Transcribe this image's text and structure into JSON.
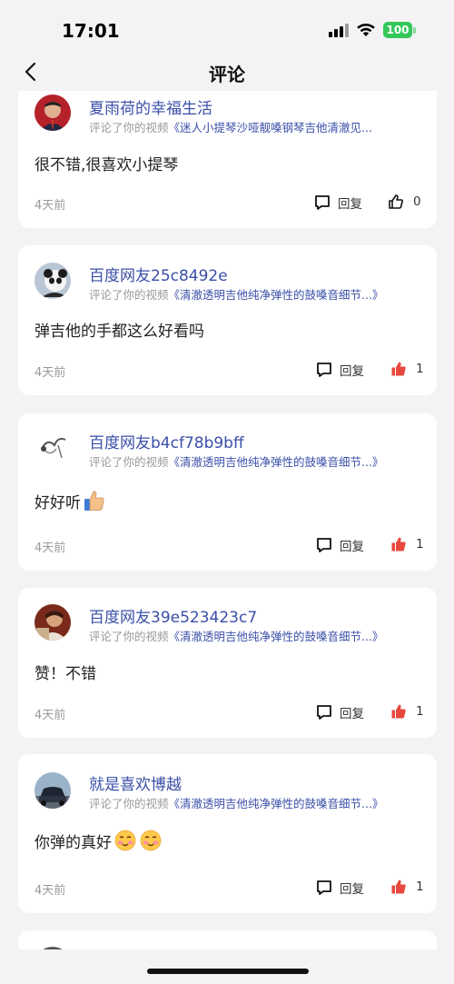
{
  "status_bar": {
    "time": "17:01",
    "battery": "100"
  },
  "nav": {
    "title": "评论"
  },
  "comments": [
    {
      "username": "夏雨荷的幸福生活",
      "prefix": "评论了你的视频",
      "video": "《迷人小提琴沙哑靓嗓钢琴吉他清澈见...",
      "text": "很不错,很喜欢小提琴",
      "time": "4天前",
      "reply_label": "回复",
      "likes": "0",
      "liked": false
    },
    {
      "username": "百度网友25c8492e",
      "prefix": "评论了你的视频",
      "video": "《清澈透明吉他纯净弹性的鼓嗓音细节...》",
      "text": "弹吉他的手都这么好看吗",
      "time": "4天前",
      "reply_label": "回复",
      "likes": "1",
      "liked": true
    },
    {
      "username": "百度网友b4cf78b9bff",
      "prefix": "评论了你的视频",
      "video": "《清澈透明吉他纯净弹性的鼓嗓音细节...》",
      "text": "好好听",
      "time": "4天前",
      "reply_label": "回复",
      "likes": "1",
      "liked": true
    },
    {
      "username": "百度网友39e523423c7",
      "prefix": "评论了你的视频",
      "video": "《清澈透明吉他纯净弹性的鼓嗓音细节...》",
      "text": "赞！不错",
      "time": "4天前",
      "reply_label": "回复",
      "likes": "1",
      "liked": true
    },
    {
      "username": "就是喜欢博越",
      "prefix": "评论了你的视频",
      "video": "《清澈透明吉他纯净弹性的鼓嗓音细节...》",
      "text": "你弹的真好",
      "time": "4天前",
      "reply_label": "回复",
      "likes": "1",
      "liked": true
    }
  ],
  "colors": {
    "link": "#3a4fa8",
    "like_active": "#e8473d",
    "background": "#f3f3f5"
  }
}
